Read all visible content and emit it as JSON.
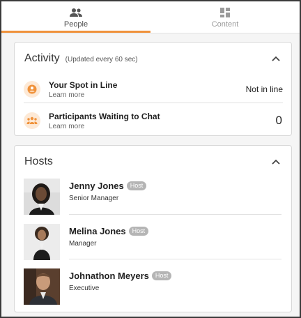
{
  "tabs": [
    {
      "label": "People",
      "icon": "people-icon",
      "active": true
    },
    {
      "label": "Content",
      "icon": "content-grid-icon",
      "active": false
    }
  ],
  "colors": {
    "accent": "#f0923b",
    "icon_bg": "#fde9d6",
    "badge_bg": "#b5b5b5"
  },
  "activity": {
    "title": "Activity",
    "subtitle": "(Updated every 60 sec)",
    "rows": [
      {
        "title": "Your Spot in Line",
        "link": "Learn more",
        "value": "Not in line",
        "icon": "person-pin-icon"
      },
      {
        "title": "Participants Waiting to Chat",
        "link": "Learn more",
        "value": "0",
        "icon": "group-icon"
      }
    ]
  },
  "hosts": {
    "title": "Hosts",
    "items": [
      {
        "name": "Jenny Jones",
        "badge": "Host",
        "role": "Senior Manager"
      },
      {
        "name": "Melina Jones",
        "badge": "Host",
        "role": "Manager"
      },
      {
        "name": "Johnathon Meyers",
        "badge": "Host",
        "role": "Executive"
      }
    ]
  }
}
